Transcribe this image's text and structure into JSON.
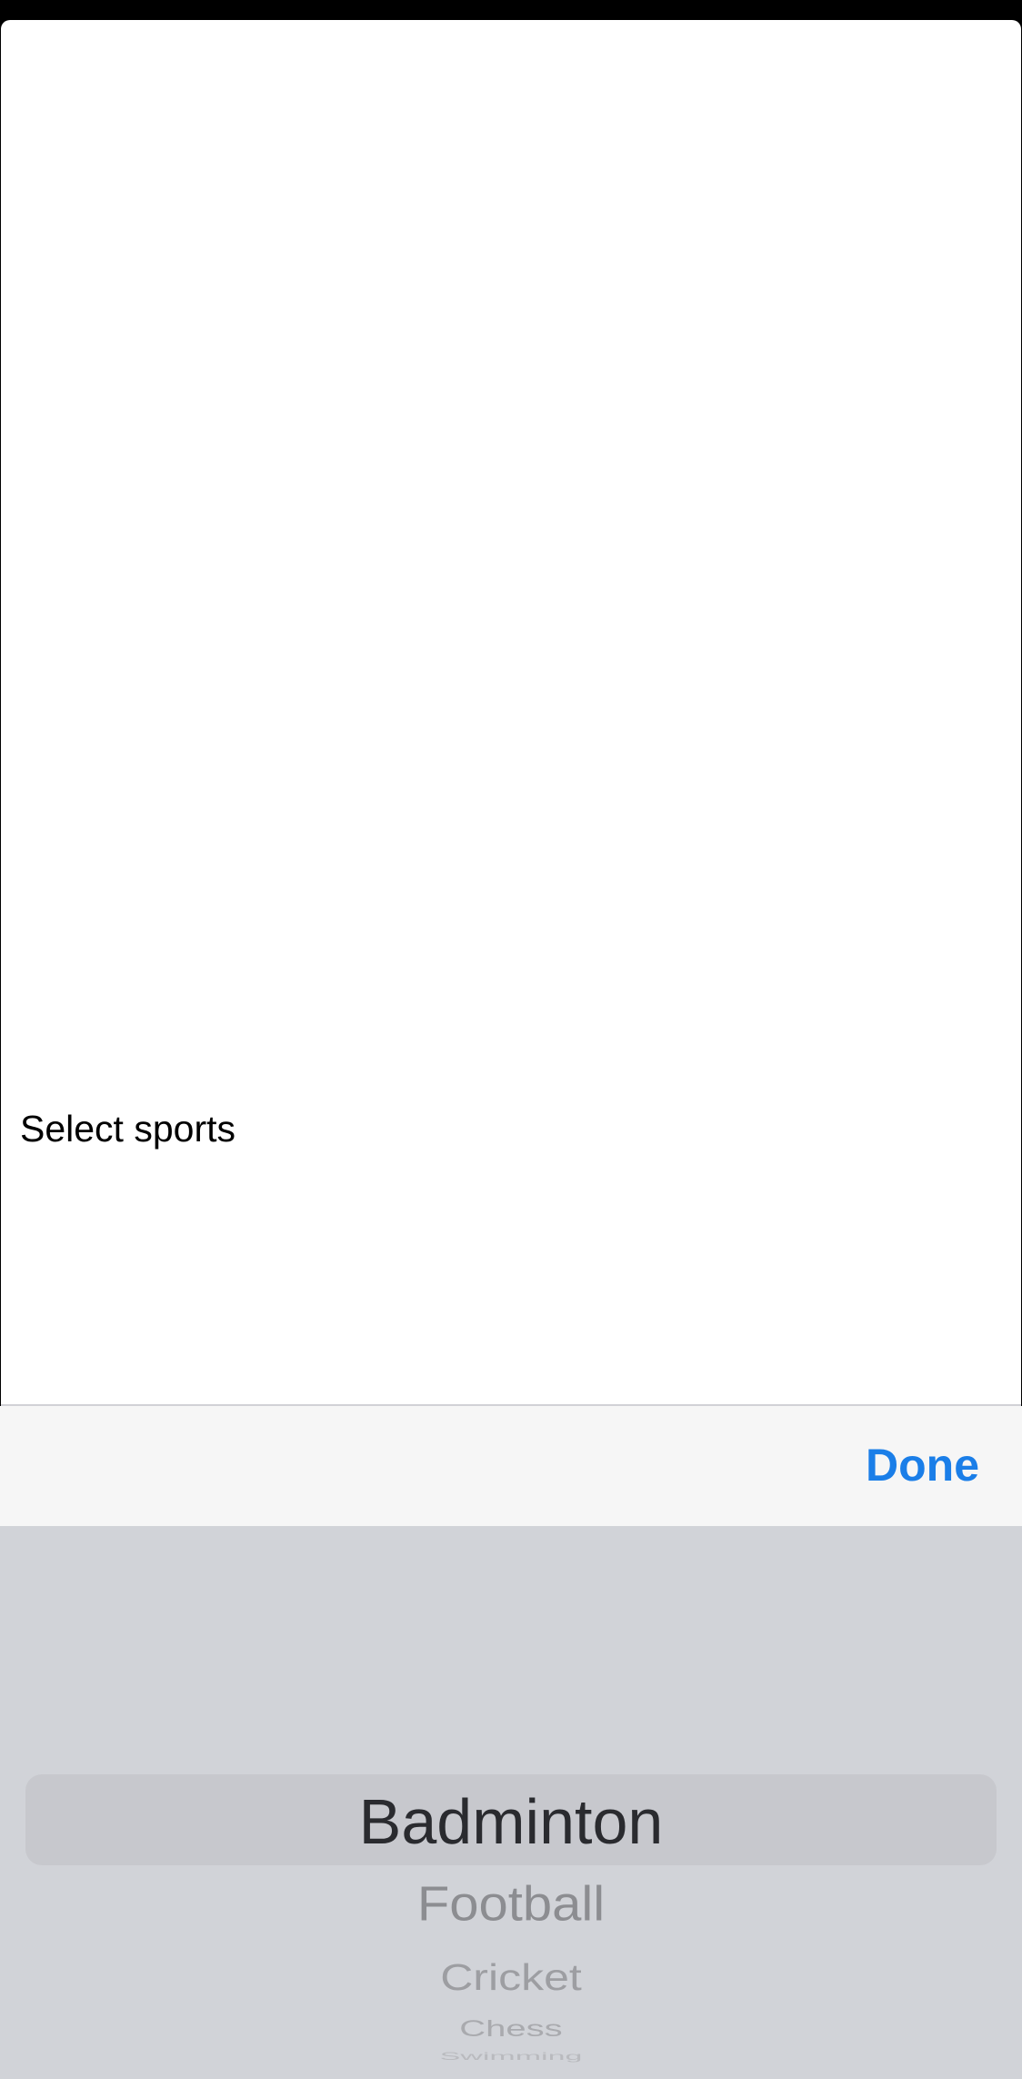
{
  "main": {
    "select_label": "Select sports"
  },
  "toolbar": {
    "done_label": "Done",
    "accent_color": "#1a7ee8"
  },
  "picker": {
    "selected": "Badminton",
    "options": [
      "Badminton",
      "Football",
      "Cricket",
      "Chess",
      "Swimming"
    ]
  }
}
